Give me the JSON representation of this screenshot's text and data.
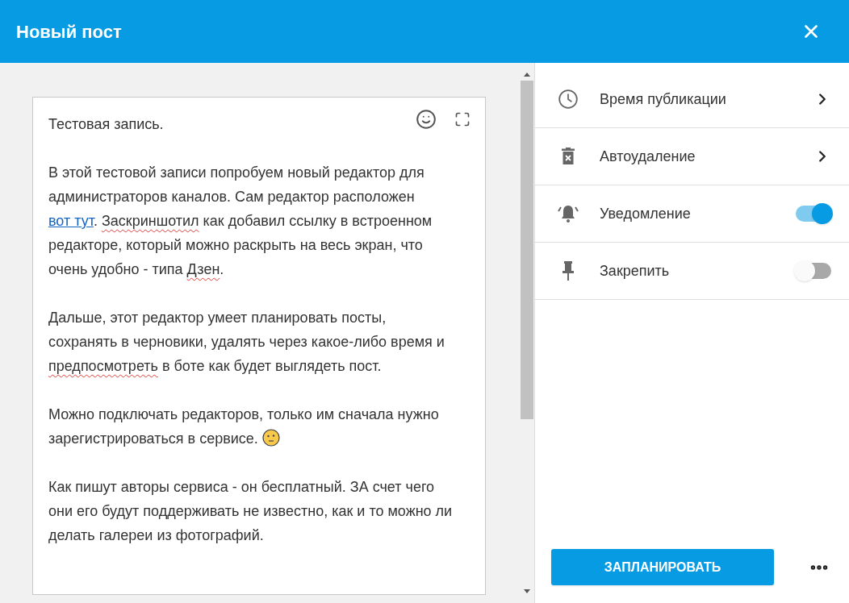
{
  "header": {
    "title": "Новый пост"
  },
  "editor": {
    "paragraphs": [
      [
        {
          "kind": "text",
          "text": "Тестовая запись."
        }
      ],
      [
        {
          "kind": "text",
          "text": "В этой тестовой записи попробуем новый редактор для администраторов каналов. Сам редактор расположен "
        },
        {
          "kind": "link",
          "text": "вот тут"
        },
        {
          "kind": "text",
          "text": ". "
        },
        {
          "kind": "misspelled",
          "text": "Заскриншотил"
        },
        {
          "kind": "text",
          "text": " как добавил ссылку в встроенном редакторе, который можно раскрыть на весь экран, что очень удобно - типа "
        },
        {
          "kind": "misspelled",
          "text": "Дзен"
        },
        {
          "kind": "text",
          "text": "."
        }
      ],
      [
        {
          "kind": "text",
          "text": "Дальше, этот редактор умеет планировать посты, сохранять в черновики, удалять через какое-либо время и "
        },
        {
          "kind": "misspelled",
          "text": "предпосмотреть"
        },
        {
          "kind": "text",
          "text": " в боте как будет выглядеть пост."
        }
      ],
      [
        {
          "kind": "text",
          "text": "Можно подключать редакторов, только им сначала нужно зарегистрироваться в сервисе. "
        },
        {
          "kind": "emoji"
        }
      ],
      [
        {
          "kind": "text",
          "text": "Как пишут авторы сервиса - он бесплатный. ЗА счет чего они его будут поддерживать не известно, как и то можно ли делать галереи из фотографий."
        }
      ]
    ]
  },
  "settings": [
    {
      "kind": "submenu",
      "label": "Время публикации"
    },
    {
      "kind": "submenu",
      "label": "Автоудаление"
    },
    {
      "kind": "toggle",
      "label": "Уведомление",
      "on": true
    },
    {
      "kind": "toggle",
      "label": "Закрепить",
      "on": false
    }
  ],
  "footer": {
    "button": "ЗАПЛАНИРОВАТЬ"
  }
}
